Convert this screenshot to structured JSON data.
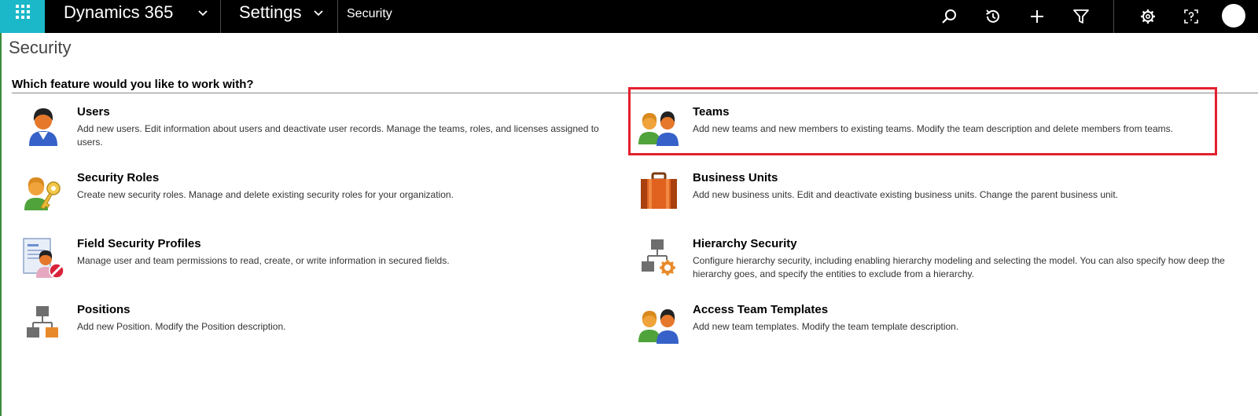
{
  "topbar": {
    "app_name": "Dynamics 365",
    "area_name": "Settings",
    "breadcrumb": "Security",
    "colors": {
      "bar": "#000000",
      "waffle": "#1ab8c8"
    },
    "icons": [
      "search-icon",
      "recent-icon",
      "add-icon",
      "filter-icon",
      "settings-icon",
      "help-icon"
    ]
  },
  "page": {
    "title": "Security",
    "section_heading": "Which feature would you like to work with?"
  },
  "features": {
    "users": {
      "title": "Users",
      "description": "Add new users. Edit information about users and deactivate user records. Manage the teams, roles, and licenses assigned to users."
    },
    "teams": {
      "title": "Teams",
      "description": "Add new teams and new members to existing teams. Modify the team description and delete members from teams."
    },
    "security_roles": {
      "title": "Security Roles",
      "description": "Create new security roles. Manage and delete existing security roles for your organization."
    },
    "business_units": {
      "title": "Business Units",
      "description": "Add new business units. Edit and deactivate existing business units. Change the parent business unit."
    },
    "field_security_profiles": {
      "title": "Field Security Profiles",
      "description": "Manage user and team permissions to read, create, or write information in secured fields."
    },
    "hierarchy_security": {
      "title": "Hierarchy Security",
      "description": "Configure hierarchy security, including enabling hierarchy modeling and selecting the model. You can also specify how deep the hierarchy goes, and specify the entities to exclude from a hierarchy."
    },
    "positions": {
      "title": "Positions",
      "description": "Add new Position. Modify the Position description."
    },
    "access_team_templates": {
      "title": "Access Team Templates",
      "description": "Add new team templates. Modify the team template description."
    }
  },
  "highlight": {
    "target": "Teams",
    "color": "#e3202e"
  }
}
